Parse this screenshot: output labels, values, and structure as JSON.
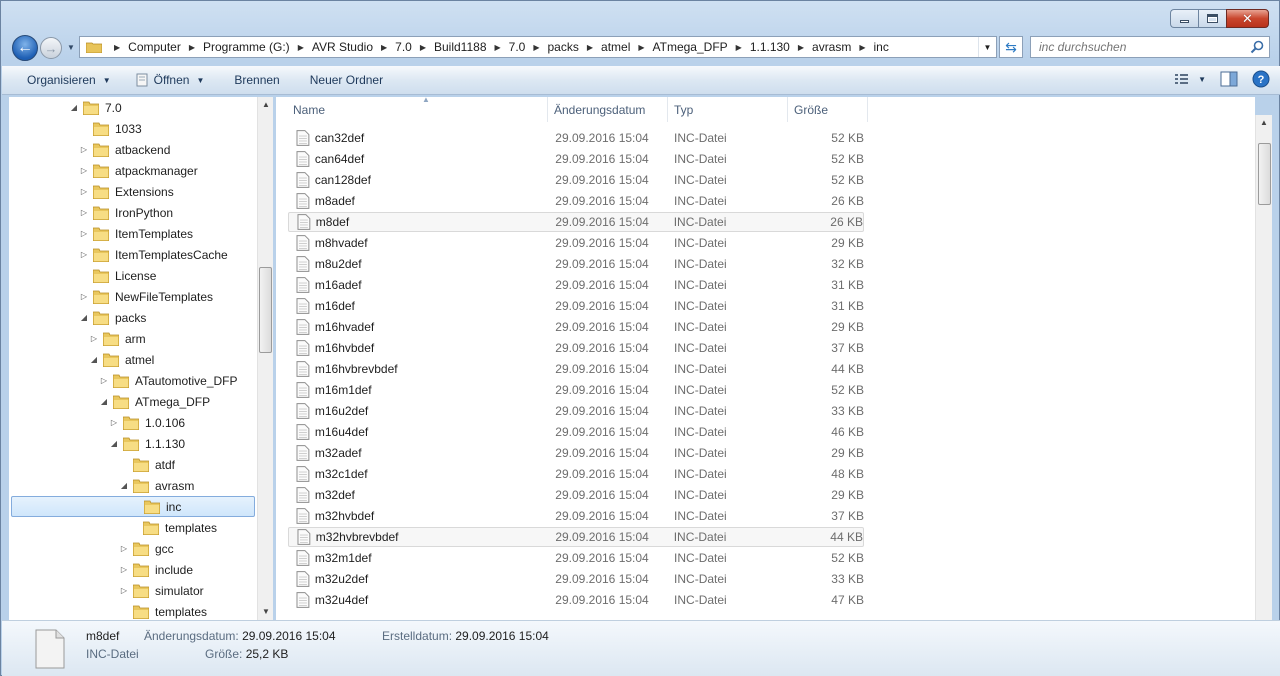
{
  "address": {
    "crumbs": [
      "Computer",
      "Programme (G:)",
      "AVR Studio",
      "7.0",
      "Build1188",
      "7.0",
      "packs",
      "atmel",
      "ATmega_DFP",
      "1.1.130",
      "avrasm",
      "inc"
    ]
  },
  "search": {
    "placeholder": "inc durchsuchen"
  },
  "toolbar": {
    "organize": "Organisieren",
    "open": "Öffnen",
    "burn": "Brennen",
    "new_folder": "Neuer Ordner"
  },
  "tree": [
    {
      "label": "7.0",
      "level": 0,
      "exp": "open"
    },
    {
      "label": "1033",
      "level": 1,
      "exp": "none"
    },
    {
      "label": "atbackend",
      "level": 1,
      "exp": "closed"
    },
    {
      "label": "atpackmanager",
      "level": 1,
      "exp": "closed"
    },
    {
      "label": "Extensions",
      "level": 1,
      "exp": "closed"
    },
    {
      "label": "IronPython",
      "level": 1,
      "exp": "closed"
    },
    {
      "label": "ItemTemplates",
      "level": 1,
      "exp": "closed"
    },
    {
      "label": "ItemTemplatesCache",
      "level": 1,
      "exp": "closed"
    },
    {
      "label": "License",
      "level": 1,
      "exp": "none"
    },
    {
      "label": "NewFileTemplates",
      "level": 1,
      "exp": "closed"
    },
    {
      "label": "packs",
      "level": 1,
      "exp": "open"
    },
    {
      "label": "arm",
      "level": 2,
      "exp": "closed"
    },
    {
      "label": "atmel",
      "level": 2,
      "exp": "open"
    },
    {
      "label": "ATautomotive_DFP",
      "level": 3,
      "exp": "closed"
    },
    {
      "label": "ATmega_DFP",
      "level": 3,
      "exp": "open"
    },
    {
      "label": "1.0.106",
      "level": 4,
      "exp": "closed"
    },
    {
      "label": "1.1.130",
      "level": 4,
      "exp": "open"
    },
    {
      "label": "atdf",
      "level": 5,
      "exp": "none"
    },
    {
      "label": "avrasm",
      "level": 5,
      "exp": "open"
    },
    {
      "label": "inc",
      "level": 6,
      "exp": "none",
      "selected": true
    },
    {
      "label": "templates",
      "level": 6,
      "exp": "none"
    },
    {
      "label": "gcc",
      "level": 5,
      "exp": "closed"
    },
    {
      "label": "include",
      "level": 5,
      "exp": "closed"
    },
    {
      "label": "simulator",
      "level": 5,
      "exp": "closed"
    },
    {
      "label": "templates",
      "level": 5,
      "exp": "none"
    }
  ],
  "columns": {
    "name": "Name",
    "date": "Änderungsdatum",
    "type": "Typ",
    "size": "Größe"
  },
  "files": [
    {
      "name": "can32def",
      "date": "29.09.2016 15:04",
      "type": "INC-Datei",
      "size": "52 KB"
    },
    {
      "name": "can64def",
      "date": "29.09.2016 15:04",
      "type": "INC-Datei",
      "size": "52 KB"
    },
    {
      "name": "can128def",
      "date": "29.09.2016 15:04",
      "type": "INC-Datei",
      "size": "52 KB"
    },
    {
      "name": "m8adef",
      "date": "29.09.2016 15:04",
      "type": "INC-Datei",
      "size": "26 KB"
    },
    {
      "name": "m8def",
      "date": "29.09.2016 15:04",
      "type": "INC-Datei",
      "size": "26 KB",
      "hl": true
    },
    {
      "name": "m8hvadef",
      "date": "29.09.2016 15:04",
      "type": "INC-Datei",
      "size": "29 KB"
    },
    {
      "name": "m8u2def",
      "date": "29.09.2016 15:04",
      "type": "INC-Datei",
      "size": "32 KB"
    },
    {
      "name": "m16adef",
      "date": "29.09.2016 15:04",
      "type": "INC-Datei",
      "size": "31 KB"
    },
    {
      "name": "m16def",
      "date": "29.09.2016 15:04",
      "type": "INC-Datei",
      "size": "31 KB"
    },
    {
      "name": "m16hvadef",
      "date": "29.09.2016 15:04",
      "type": "INC-Datei",
      "size": "29 KB"
    },
    {
      "name": "m16hvbdef",
      "date": "29.09.2016 15:04",
      "type": "INC-Datei",
      "size": "37 KB"
    },
    {
      "name": "m16hvbrevbdef",
      "date": "29.09.2016 15:04",
      "type": "INC-Datei",
      "size": "44 KB"
    },
    {
      "name": "m16m1def",
      "date": "29.09.2016 15:04",
      "type": "INC-Datei",
      "size": "52 KB"
    },
    {
      "name": "m16u2def",
      "date": "29.09.2016 15:04",
      "type": "INC-Datei",
      "size": "33 KB"
    },
    {
      "name": "m16u4def",
      "date": "29.09.2016 15:04",
      "type": "INC-Datei",
      "size": "46 KB"
    },
    {
      "name": "m32adef",
      "date": "29.09.2016 15:04",
      "type": "INC-Datei",
      "size": "29 KB"
    },
    {
      "name": "m32c1def",
      "date": "29.09.2016 15:04",
      "type": "INC-Datei",
      "size": "48 KB"
    },
    {
      "name": "m32def",
      "date": "29.09.2016 15:04",
      "type": "INC-Datei",
      "size": "29 KB"
    },
    {
      "name": "m32hvbdef",
      "date": "29.09.2016 15:04",
      "type": "INC-Datei",
      "size": "37 KB"
    },
    {
      "name": "m32hvbrevbdef",
      "date": "29.09.2016 15:04",
      "type": "INC-Datei",
      "size": "44 KB",
      "hl": true
    },
    {
      "name": "m32m1def",
      "date": "29.09.2016 15:04",
      "type": "INC-Datei",
      "size": "52 KB"
    },
    {
      "name": "m32u2def",
      "date": "29.09.2016 15:04",
      "type": "INC-Datei",
      "size": "33 KB"
    },
    {
      "name": "m32u4def",
      "date": "29.09.2016 15:04",
      "type": "INC-Datei",
      "size": "47 KB"
    }
  ],
  "details": {
    "name": "m8def",
    "type": "INC-Datei",
    "modified_label": "Änderungsdatum:",
    "modified_value": "29.09.2016 15:04",
    "created_label": "Erstelldatum:",
    "created_value": "29.09.2016 15:04",
    "size_label": "Größe:",
    "size_value": "25,2 KB"
  }
}
